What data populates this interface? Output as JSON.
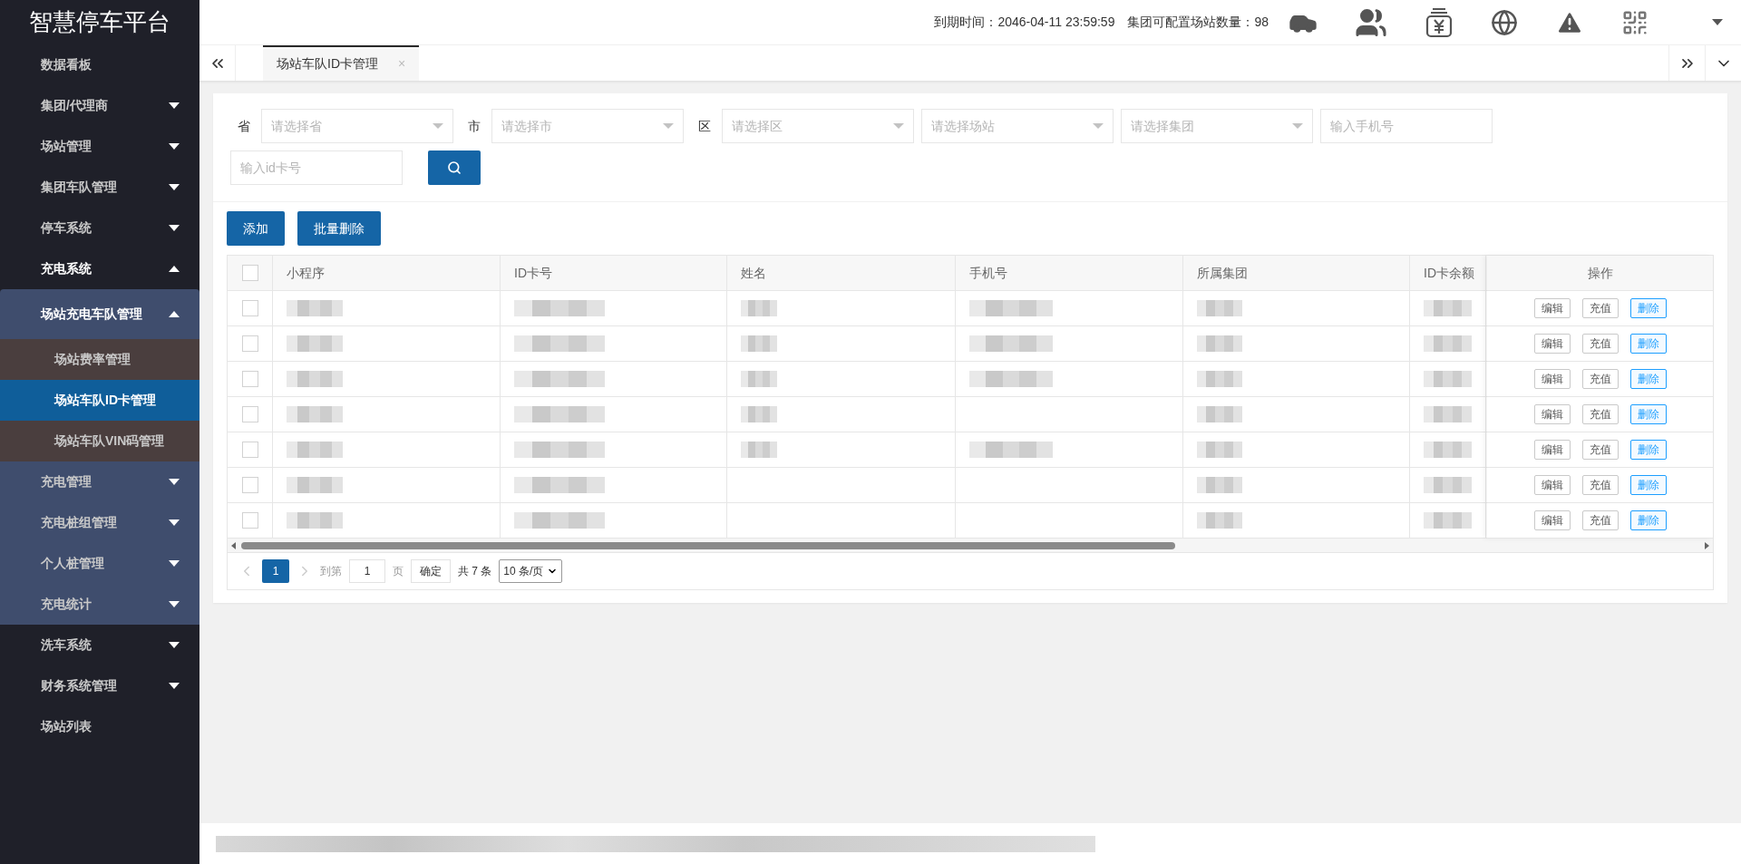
{
  "brand": "智慧停车平台",
  "header": {
    "expiry": "到期时间：2046-04-11 23:59:59",
    "quota": "集团可配置场站数量：98"
  },
  "sidebar": {
    "items": [
      {
        "label": "数据看板",
        "selected": false
      },
      {
        "label": "集团/代理商",
        "selected": false,
        "expanded": false
      },
      {
        "label": "场站管理",
        "selected": false,
        "expanded": false
      },
      {
        "label": "集团车队管理",
        "selected": false,
        "expanded": false
      },
      {
        "label": "停车系统",
        "selected": false,
        "expanded": false
      },
      {
        "label": "充电系统",
        "selected": false,
        "expanded": true,
        "children": [
          {
            "label": "场站充电车队管理",
            "selected": false,
            "expanded": true,
            "children": [
              {
                "label": "场站费率管理",
                "selected": false
              },
              {
                "label": "场站车队ID卡管理",
                "selected": true
              },
              {
                "label": "场站车队VIN码管理",
                "selected": false
              }
            ]
          },
          {
            "label": "充电管理",
            "selected": false,
            "expanded": false
          },
          {
            "label": "充电桩组管理",
            "selected": false,
            "expanded": false
          },
          {
            "label": "个人桩管理",
            "selected": false,
            "expanded": false
          },
          {
            "label": "充电统计",
            "selected": false,
            "expanded": false
          }
        ]
      },
      {
        "label": "洗车系统",
        "selected": false,
        "expanded": false
      },
      {
        "label": "财务系统管理",
        "selected": false,
        "expanded": false
      },
      {
        "label": "场站列表",
        "selected": false
      }
    ]
  },
  "tabs": [
    {
      "label": "场站车队ID卡管理",
      "selected": true,
      "close": "×"
    }
  ],
  "filter_rows": [
    [
      {
        "kind": "select",
        "label": "省",
        "placeholder": "请选择省"
      },
      {
        "kind": "select",
        "label": "市",
        "placeholder": "请选择市"
      },
      {
        "kind": "select",
        "label": "区",
        "placeholder": "请选择区"
      },
      {
        "kind": "select",
        "placeholder": "请选择场站"
      },
      {
        "kind": "select",
        "placeholder": "请选择集团"
      },
      {
        "kind": "input",
        "placeholder": "输入手机号"
      }
    ],
    [
      {
        "kind": "input",
        "placeholder": "输入id卡号"
      },
      {
        "kind": "search"
      }
    ]
  ],
  "actions": [
    "添加",
    "批量删除"
  ],
  "table": {
    "all_checked": false,
    "columns": [
      "小程序",
      "ID卡号",
      "姓名",
      "手机号",
      "所属集团",
      "ID卡余额",
      "操作"
    ],
    "rows": [
      {
        "checked": false,
        "blurred": [
          true,
          true,
          true,
          true,
          true,
          true
        ],
        "actions": [
          {
            "label": "编辑",
            "kind": "plain"
          },
          {
            "label": "充值",
            "kind": "plain"
          },
          {
            "label": "删除",
            "kind": "primary"
          }
        ]
      },
      {
        "checked": false,
        "blurred": [
          true,
          true,
          true,
          true,
          true,
          true
        ],
        "actions": [
          {
            "label": "编辑",
            "kind": "plain"
          },
          {
            "label": "充值",
            "kind": "plain"
          },
          {
            "label": "删除",
            "kind": "primary"
          }
        ]
      },
      {
        "checked": false,
        "blurred": [
          true,
          true,
          true,
          true,
          true,
          true
        ],
        "actions": [
          {
            "label": "编辑",
            "kind": "plain"
          },
          {
            "label": "充值",
            "kind": "plain"
          },
          {
            "label": "删除",
            "kind": "primary"
          }
        ]
      },
      {
        "checked": false,
        "blurred": [
          true,
          true,
          true,
          false,
          true,
          true
        ],
        "actions": [
          {
            "label": "编辑",
            "kind": "plain"
          },
          {
            "label": "充值",
            "kind": "plain"
          },
          {
            "label": "删除",
            "kind": "primary"
          }
        ]
      },
      {
        "checked": false,
        "blurred": [
          true,
          true,
          true,
          true,
          true,
          true
        ],
        "actions": [
          {
            "label": "编辑",
            "kind": "plain"
          },
          {
            "label": "充值",
            "kind": "plain"
          },
          {
            "label": "删除",
            "kind": "primary"
          }
        ]
      },
      {
        "checked": false,
        "blurred": [
          true,
          true,
          false,
          false,
          true,
          true
        ],
        "actions": [
          {
            "label": "编辑",
            "kind": "plain"
          },
          {
            "label": "充值",
            "kind": "plain"
          },
          {
            "label": "删除",
            "kind": "primary"
          }
        ]
      },
      {
        "checked": false,
        "blurred": [
          true,
          true,
          false,
          false,
          true,
          true
        ],
        "actions": [
          {
            "label": "编辑",
            "kind": "plain"
          },
          {
            "label": "充值",
            "kind": "plain"
          },
          {
            "label": "删除",
            "kind": "primary"
          }
        ]
      }
    ]
  },
  "pagination": {
    "pages": [
      {
        "label": "1",
        "selected": true
      }
    ],
    "goto": "到第",
    "page_value": "1",
    "page_unit": "页",
    "confirm": "确定",
    "total": "共 7 条",
    "page_size": "10 条/页"
  }
}
